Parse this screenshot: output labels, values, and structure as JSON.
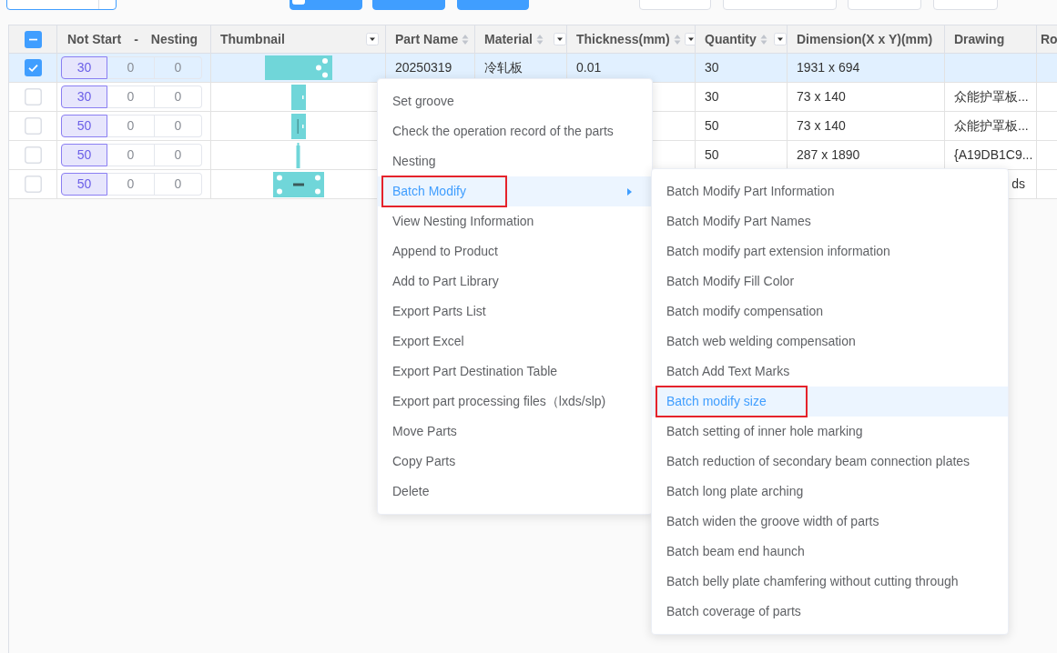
{
  "toolbar": [
    {
      "kind": "select"
    },
    {
      "kind": "primary",
      "icon": true
    },
    {
      "kind": "primary",
      "icon": false
    },
    {
      "kind": "primary",
      "icon": false
    },
    {
      "kind": "outline"
    },
    {
      "kind": "outline"
    },
    {
      "kind": "outline"
    },
    {
      "kind": "outline"
    }
  ],
  "table": {
    "select_all_indeterminate": true,
    "columns": [
      {
        "kind": "check"
      },
      {
        "kind": "counts",
        "labels": [
          "Not Start",
          "-",
          "Nesting"
        ]
      },
      {
        "kind": "image",
        "label": "Thumbnail",
        "sortable": false,
        "filter": true
      },
      {
        "kind": "text",
        "label": "Part Name",
        "sortable": true,
        "filter": false
      },
      {
        "kind": "text",
        "label": "Material",
        "sortable": true,
        "filter": true
      },
      {
        "kind": "text",
        "label": "Thickness(mm)",
        "sortable": true,
        "filter": true
      },
      {
        "kind": "text",
        "label": "Quantity",
        "sortable": true,
        "filter": true
      },
      {
        "kind": "text",
        "label": "Dimension(X x Y)(mm)",
        "sortable": false,
        "filter": false
      },
      {
        "kind": "text",
        "label": "Drawing",
        "sortable": false,
        "filter": false
      },
      {
        "kind": "text",
        "label": "Ro",
        "sortable": false,
        "filter": false
      }
    ],
    "rows": [
      {
        "selected": true,
        "checked": true,
        "counts": [
          "30",
          "0",
          "0"
        ],
        "thumbnail": {
          "kind": "wide"
        },
        "part_name": "20250319",
        "material": "冷轧板",
        "thickness": "0.01",
        "quantity": "30",
        "dimension": "1931 x 694"
      },
      {
        "selected": false,
        "checked": false,
        "counts": [
          "30",
          "0",
          "0"
        ],
        "thumbnail": {
          "kind": "narrow"
        },
        "quantity": "30",
        "dimension": "73 x 140",
        "drawing": "众能护罩板...",
        "drawing_partly_hidden": false
      },
      {
        "selected": false,
        "checked": false,
        "counts": [
          "50",
          "0",
          "0"
        ],
        "thumbnail": {
          "kind": "narrow-slot"
        },
        "quantity": "50",
        "dimension": "73 x 140",
        "drawing": "众能护罩板...",
        "drawing_partly_hidden": false
      },
      {
        "selected": false,
        "checked": false,
        "counts": [
          "50",
          "0",
          "0"
        ],
        "thumbnail": {
          "kind": "strip"
        },
        "quantity": "50",
        "dimension": "287 x 1890",
        "drawing": "{A19DB1C9...",
        "drawing_partly_hidden": false
      },
      {
        "selected": false,
        "checked": false,
        "counts": [
          "50",
          "0",
          "0"
        ],
        "thumbnail": {
          "kind": "plate"
        },
        "drawing": "ds",
        "drawing_partly_hidden": true
      }
    ]
  },
  "context_menu": {
    "items": [
      {
        "label": "Set groove",
        "selected": false,
        "has_submenu": false,
        "boxed": false
      },
      {
        "label": "Check the operation record of the parts",
        "selected": false,
        "has_submenu": false,
        "boxed": false
      },
      {
        "label": "Nesting",
        "selected": false,
        "has_submenu": false,
        "boxed": false
      },
      {
        "label": "Batch Modify",
        "selected": true,
        "has_submenu": true,
        "boxed": true
      },
      {
        "label": "View Nesting Information",
        "selected": false,
        "has_submenu": false,
        "boxed": false
      },
      {
        "label": "Append to Product",
        "selected": false,
        "has_submenu": false,
        "boxed": false
      },
      {
        "label": "Add to Part Library",
        "selected": false,
        "has_submenu": false,
        "boxed": false
      },
      {
        "label": "Export Parts List",
        "selected": false,
        "has_submenu": false,
        "boxed": false
      },
      {
        "label": "Export Excel",
        "selected": false,
        "has_submenu": false,
        "boxed": false
      },
      {
        "label": "Export Part Destination Table",
        "selected": false,
        "has_submenu": false,
        "boxed": false
      },
      {
        "label": "Export part processing files（lxds/slp)",
        "selected": false,
        "has_submenu": false,
        "boxed": false
      },
      {
        "label": "Move Parts",
        "selected": false,
        "has_submenu": false,
        "boxed": false
      },
      {
        "label": "Copy Parts",
        "selected": false,
        "has_submenu": false,
        "boxed": false
      },
      {
        "label": "Delete",
        "selected": false,
        "has_submenu": false,
        "boxed": false
      }
    ]
  },
  "submenu": {
    "items": [
      {
        "label": "Batch Modify Part Information",
        "selected": false,
        "has_submenu": false,
        "boxed": false
      },
      {
        "label": "Batch Modify Part Names",
        "selected": false,
        "has_submenu": false,
        "boxed": false
      },
      {
        "label": "Batch modify part extension information",
        "selected": false,
        "has_submenu": false,
        "boxed": false
      },
      {
        "label": "Batch Modify Fill Color",
        "selected": false,
        "has_submenu": false,
        "boxed": false
      },
      {
        "label": "Batch modify compensation",
        "selected": false,
        "has_submenu": false,
        "boxed": false
      },
      {
        "label": "Batch web welding compensation",
        "selected": false,
        "has_submenu": false,
        "boxed": false
      },
      {
        "label": "Batch Add Text Marks",
        "selected": false,
        "has_submenu": false,
        "boxed": false
      },
      {
        "label": "Batch modify size",
        "selected": true,
        "has_submenu": false,
        "boxed": true
      },
      {
        "label": "Batch setting of inner hole marking",
        "selected": false,
        "has_submenu": false,
        "boxed": false
      },
      {
        "label": "Batch reduction of secondary beam connection plates",
        "selected": false,
        "has_submenu": false,
        "boxed": false
      },
      {
        "label": "Batch long plate arching",
        "selected": false,
        "has_submenu": false,
        "boxed": false
      },
      {
        "label": "Batch widen the groove width of parts",
        "selected": false,
        "has_submenu": false,
        "boxed": false
      },
      {
        "label": "Batch beam end haunch",
        "selected": false,
        "has_submenu": false,
        "boxed": false
      },
      {
        "label": "Batch belly plate chamfering without cutting through",
        "selected": false,
        "has_submenu": false,
        "boxed": false
      },
      {
        "label": "Batch coverage of parts",
        "selected": false,
        "has_submenu": false,
        "boxed": false
      }
    ]
  }
}
